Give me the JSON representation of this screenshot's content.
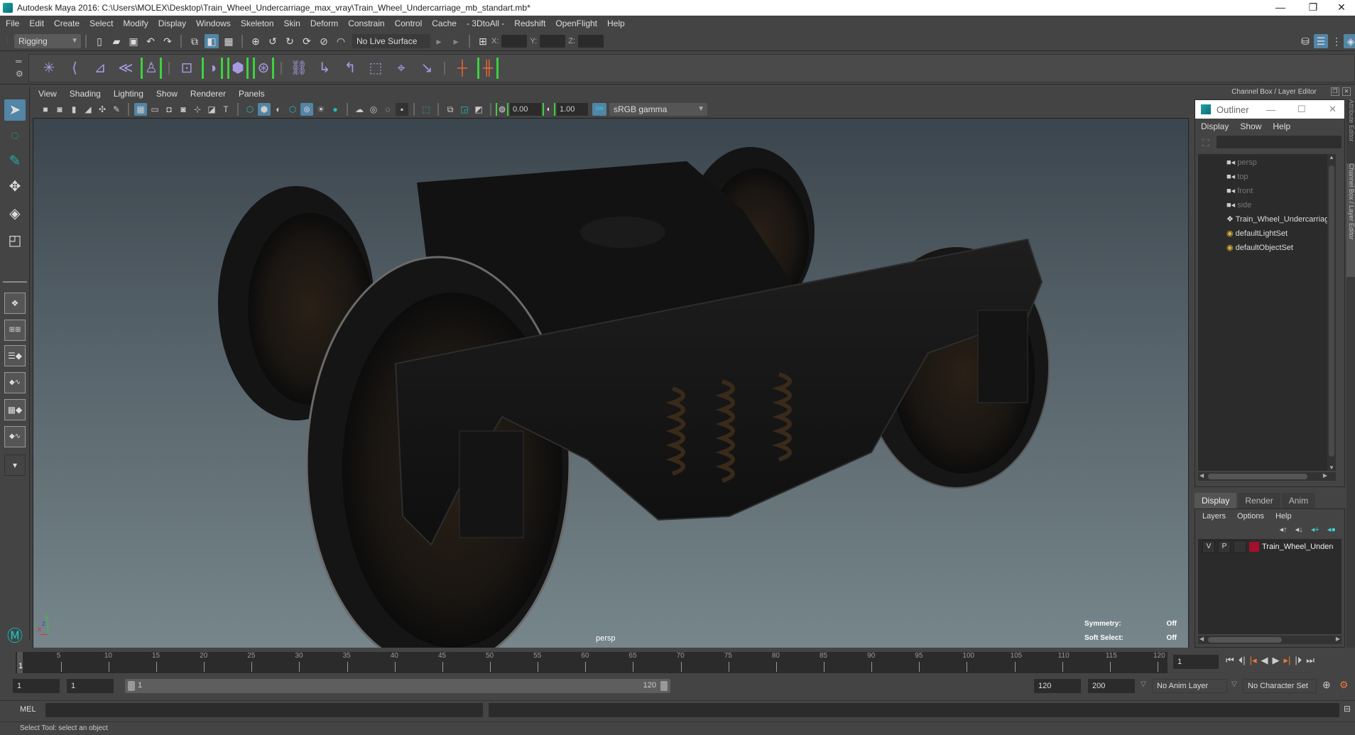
{
  "window": {
    "title": "Autodesk Maya 2016: C:\\Users\\MOLEX\\Desktop\\Train_Wheel_Undercarriage_max_vray\\Train_Wheel_Undercarriage_mb_standart.mb*",
    "minimize": "—",
    "restore": "❐",
    "close": "✕"
  },
  "menubar": [
    "File",
    "Edit",
    "Create",
    "Select",
    "Modify",
    "Display",
    "Windows",
    "Skeleton",
    "Skin",
    "Deform",
    "Constrain",
    "Control",
    "Cache",
    "- 3DtoAll -",
    "Redshift",
    "OpenFlight",
    "Help"
  ],
  "statusline": {
    "menuset": "Rigging",
    "live_surface": "No Live Surface",
    "x_label": "X:",
    "y_label": "Y:",
    "z_label": "Z:",
    "x_value": "",
    "y_value": "",
    "z_value": ""
  },
  "shelf": {
    "icons": [
      "joint-tool",
      "ik-handle",
      "ik-spline",
      "insert-joint",
      "quick-rig",
      "paint-skin-weights",
      "smooth-bind",
      "blend-shape",
      "lattice",
      "parent-constraint",
      "point-constraint",
      "orient-constraint",
      "scale-constraint",
      "aim-constraint",
      "pole-vector",
      "hide-joint",
      "mirror-joint"
    ]
  },
  "viewport": {
    "menu": [
      "View",
      "Shading",
      "Lighting",
      "Show",
      "Renderer",
      "Panels"
    ],
    "exposure": "0.00",
    "gamma": "1.00",
    "colorspace_toggle": "ON",
    "colorspace": "sRGB gamma",
    "camera_label": "persp",
    "hud": [
      {
        "label": "Symmetry:",
        "value": "Off"
      },
      {
        "label": "Soft Select:",
        "value": "Off"
      }
    ],
    "axis": {
      "x": "x",
      "y": "y",
      "z": "z"
    },
    "colors": {
      "x": "#e0302f",
      "y": "#3ac43a",
      "z": "#2f4de0"
    }
  },
  "channelbox": {
    "header": "Channel Box / Layer Editor",
    "side_tabs": [
      "Attribute Editor",
      "Channel Box / Layer Editor"
    ]
  },
  "outliner": {
    "title": "Outliner",
    "menu": [
      "Display",
      "Show",
      "Help"
    ],
    "items": [
      {
        "label": "persp",
        "icon": "camera-icon",
        "dim": true
      },
      {
        "label": "top",
        "icon": "camera-icon",
        "dim": true
      },
      {
        "label": "front",
        "icon": "camera-icon",
        "dim": true
      },
      {
        "label": "side",
        "icon": "camera-icon",
        "dim": true
      },
      {
        "label": "Train_Wheel_Undercarriag",
        "icon": "mesh-group-icon",
        "dim": false
      },
      {
        "label": "defaultLightSet",
        "icon": "set-icon",
        "dim": false
      },
      {
        "label": "defaultObjectSet",
        "icon": "set-icon",
        "dim": false
      }
    ]
  },
  "layer_editor": {
    "tabs": [
      "Display",
      "Render",
      "Anim"
    ],
    "active_tab": "Display",
    "menu": [
      "Layers",
      "Options",
      "Help"
    ],
    "layers": [
      {
        "v": "V",
        "p": "P",
        "name": "Train_Wheel_Undercar",
        "color": "#a3102a"
      }
    ]
  },
  "timeline": {
    "ticks": [
      "5",
      "10",
      "15",
      "20",
      "25",
      "30",
      "35",
      "40",
      "45",
      "50",
      "55",
      "60",
      "65",
      "70",
      "75",
      "80",
      "85",
      "90",
      "95",
      "100",
      "105",
      "110",
      "115",
      "120"
    ],
    "current_frame_marker": "1",
    "current_frame": "1"
  },
  "range": {
    "start": "1",
    "playback_start": "1",
    "slider_start": "1",
    "slider_end": "120",
    "playback_end": "120",
    "end": "200",
    "anim_layer": "No Anim Layer",
    "character_set": "No Character Set"
  },
  "command": {
    "language": "MEL",
    "input": "",
    "output": ""
  },
  "help_line": "Select Tool: select an object"
}
